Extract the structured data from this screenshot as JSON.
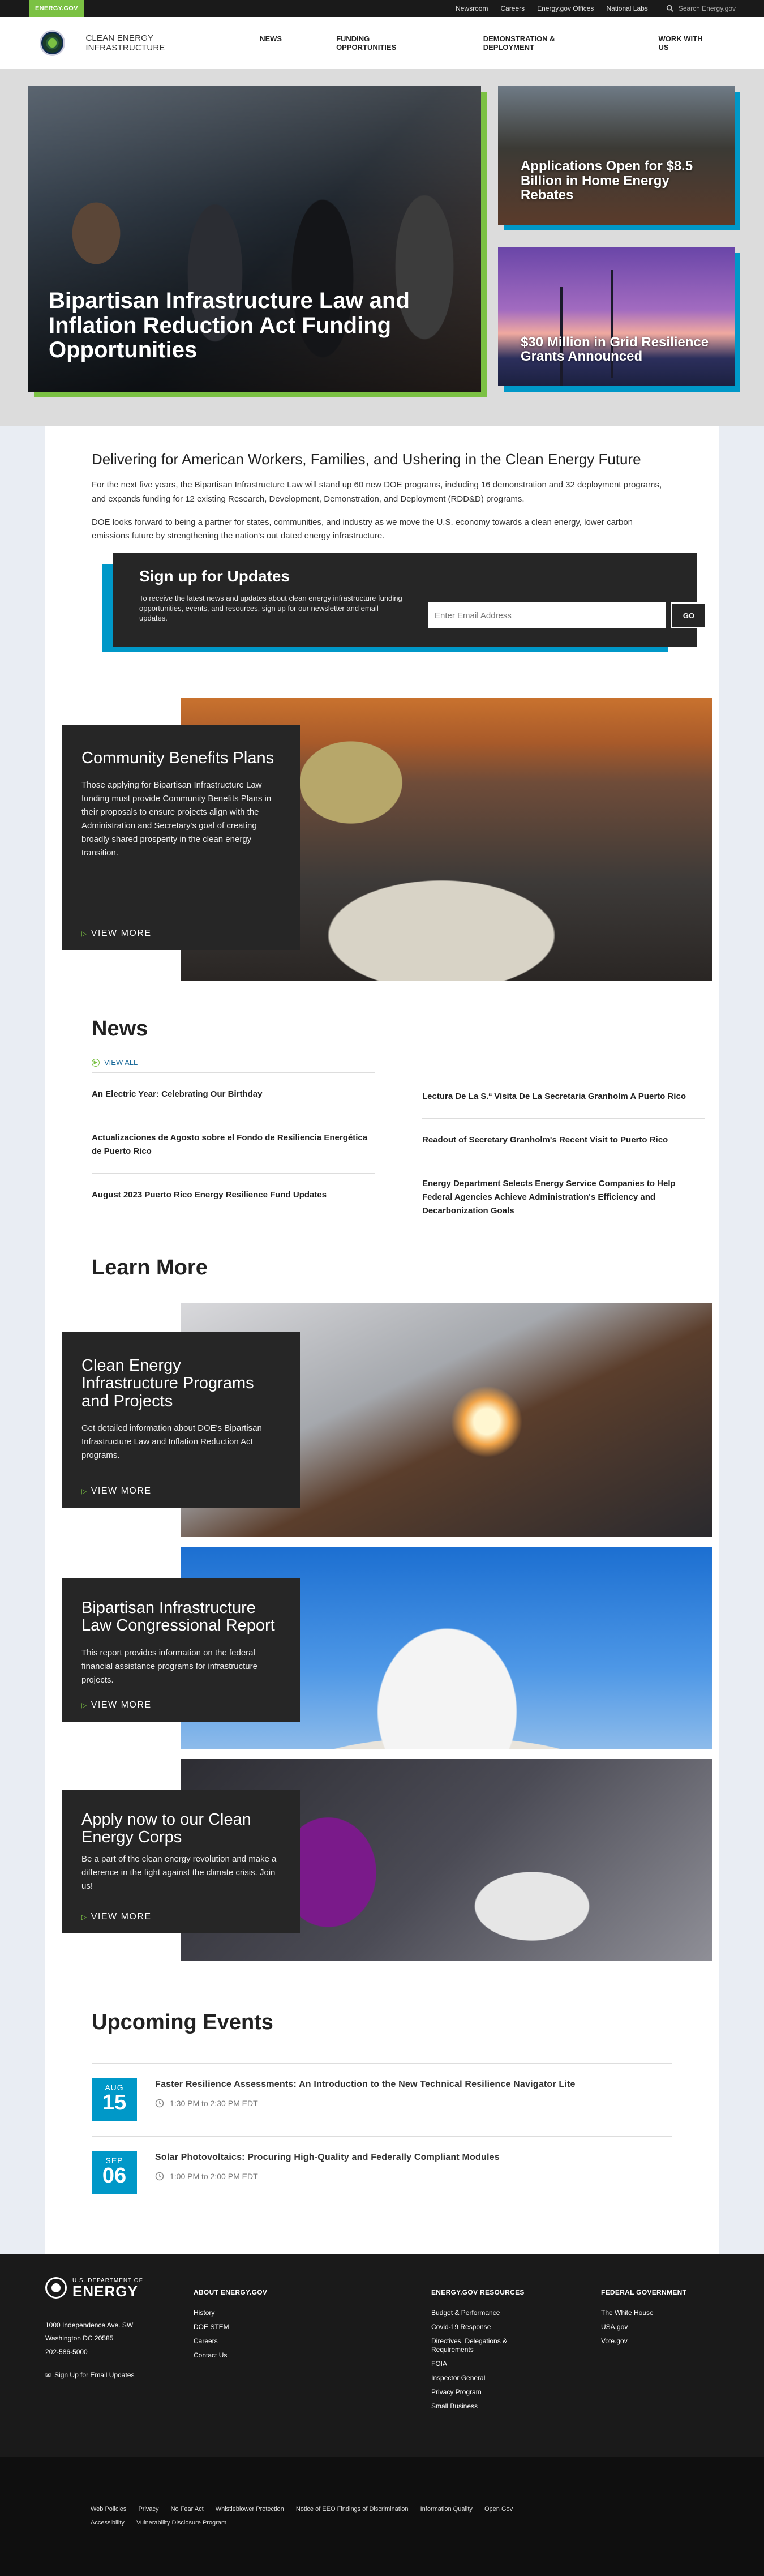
{
  "utility": {
    "badge": "ENERGY.GOV",
    "links": [
      "Newsroom",
      "Careers",
      "Energy.gov Offices",
      "National Labs"
    ],
    "search_placeholder": "Search Energy.gov"
  },
  "header": {
    "site_name": "CLEAN ENERGY INFRASTRUCTURE",
    "nav": [
      "NEWS",
      "FUNDING OPPORTUNITIES",
      "DEMONSTRATION & DEPLOYMENT",
      "WORK WITH US"
    ]
  },
  "hero": {
    "main_title": "Bipartisan Infrastructure Law and Inflation Reduction Act Funding Opportunities",
    "cards": [
      "Applications Open for $8.5 Billion in Home Energy Rebates",
      "$30 Million in Grid Resilience Grants Announced"
    ]
  },
  "intro": {
    "heading": "Delivering for American Workers, Families, and Ushering in the Clean Energy Future",
    "p1": "For the next five years, the Bipartisan Infrastructure Law will stand up 60 new DOE programs, including 16 demonstration and 32 deployment programs, and expands funding for 12 existing Research, Development, Demonstration, and Deployment (RDD&D) programs.",
    "p2": "DOE looks forward to being a partner for states, communities, and industry as we move the U.S. economy towards a clean energy, lower carbon emissions future by strengthening the nation's out dated energy infrastructure."
  },
  "signup": {
    "title": "Sign up for Updates",
    "text": "To receive the latest news and updates about clean energy infrastructure funding opportunities, events, and resources, sign up for our newsletter and email updates.",
    "placeholder": "Enter Email Address",
    "button": "GO"
  },
  "community": {
    "title": "Community Benefits Plans",
    "text": "Those applying for Bipartisan Infrastructure Law funding must provide Community Benefits Plans in their proposals to ensure projects align with the Administration and Secretary's goal of creating broadly shared prosperity in the clean energy transition.",
    "link": "VIEW MORE"
  },
  "news": {
    "title": "News",
    "view_all": "VIEW ALL",
    "left": [
      "An Electric Year: Celebrating Our Birthday",
      "Actualizaciones de Agosto sobre el Fondo de Resiliencia Energética de Puerto Rico",
      "August 2023 Puerto Rico Energy Resilience Fund Updates"
    ],
    "right": [
      "Lectura De La S.ª Visita De La Secretaria Granholm A Puerto Rico",
      "Readout of Secretary Granholm's Recent Visit to Puerto Rico",
      "Energy Department Selects Energy Service Companies to Help Federal Agencies Achieve Administration's Efficiency and Decarbonization Goals"
    ]
  },
  "learn": {
    "title": "Learn More",
    "items": [
      {
        "title": "Clean Energy Infrastructure Programs and Projects",
        "text": "Get detailed information about DOE's Bipartisan Infrastructure Law and Inflation Reduction Act programs.",
        "link": "VIEW MORE"
      },
      {
        "title": "Bipartisan Infrastructure Law Congressional Report",
        "text": "This report provides information on the federal financial assistance programs for infrastructure projects.",
        "link": "VIEW MORE"
      },
      {
        "title": "Apply now to our Clean Energy Corps",
        "text": "Be a part of the clean energy revolution and make a difference in the fight against the climate crisis. Join us!",
        "link": "VIEW MORE"
      }
    ]
  },
  "events": {
    "title": "Upcoming Events",
    "items": [
      {
        "month": "AUG",
        "day": "15",
        "title": "Faster Resilience Assessments: An Introduction to the New Technical Resilience Navigator Lite",
        "time": "1:30 PM to 2:30 PM EDT"
      },
      {
        "month": "SEP",
        "day": "06",
        "title": "Solar Photovoltaics: Procuring High-Quality and Federally Compliant Modules",
        "time": "1:00 PM to 2:00 PM EDT"
      }
    ]
  },
  "footer": {
    "logo_small": "U.S. DEPARTMENT OF",
    "logo_big": "ENERGY",
    "address1": "1000 Independence Ave. SW",
    "address2": "Washington DC 20585",
    "phone": "202-586-5000",
    "email_signup": "Sign Up for Email Updates",
    "col1_title": "ABOUT ENERGY.GOV",
    "col1": [
      "History",
      "DOE STEM",
      "Careers",
      "Contact Us"
    ],
    "col2_title": "ENERGY.GOV RESOURCES",
    "col2": [
      "Budget & Performance",
      "Covid-19 Response",
      "Directives, Delegations & Requirements",
      "FOIA",
      "Inspector General",
      "Privacy Program",
      "Small Business"
    ],
    "col3_title": "FEDERAL GOVERNMENT",
    "col3": [
      "The White House",
      "USA.gov",
      "Vote.gov"
    ],
    "legal": [
      "Web Policies",
      "Privacy",
      "No Fear Act",
      "Whistleblower Protection",
      "Notice of EEO Findings of Discrimination",
      "Information Quality",
      "Open Gov",
      "Accessibility",
      "Vulnerability Disclosure Program"
    ]
  },
  "colors": {
    "green": "#7bc143",
    "blue": "#0098c8",
    "dark": "#262626"
  }
}
